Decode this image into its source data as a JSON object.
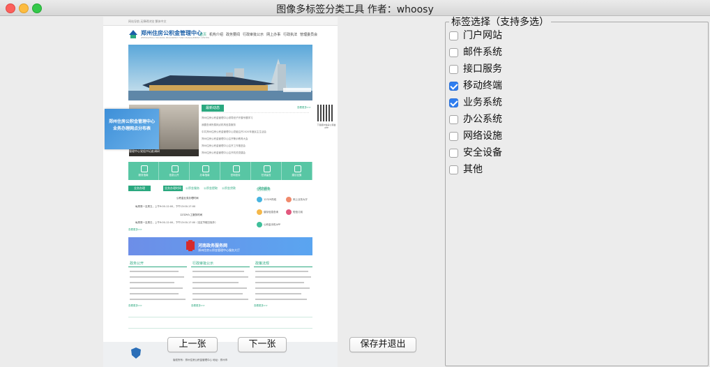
{
  "window": {
    "title": "图像多标签分类工具    作者：whoosy"
  },
  "preview": {
    "site_name": "郑州住房公积金管理中心",
    "site_sub": "ZHENGZHOU HOUSING PROVIDENT FUND MANAGEMENT CENTER",
    "top_links": "网站导航  无障碍浏览  繁体中文",
    "nav": [
      "首页",
      "机构介绍",
      "政务要闻",
      "行政审批公示",
      "网上办事",
      "行政执法",
      "管理委员会"
    ],
    "side_banner": "郑州住房公积金管理中心 业务办理网点分布表",
    "photo_caption": "管理中心党组书记赴调研",
    "news_head": "最新动态",
    "news_more": "查看更多>>",
    "news": [
      "郑州住房公积金管理中心领导班子开展专题学习",
      "我要查询所属网点机构信息服务",
      "中共郑州住房公积金管理中心党组召开2020年度民主生活会",
      "郑州住房公积金管理中心召开警示教育大会",
      "郑州住房公积金管理中心召开工作推进会",
      "郑州住房公积金管理中心召开机关党建会"
    ],
    "qr_caption": "下载郑州住房公积金APP",
    "tiles": [
      "服务指南",
      "信息公开",
      "办事指南",
      "咨询投诉",
      "在线留言",
      "建议征集"
    ],
    "section_tabs": [
      "业务办理",
      "业务办理时间",
      "公积金服务",
      "公积金提取",
      "公积金贷款",
      "政务服务"
    ],
    "hours_title": "公积金业务办理时间",
    "hours_line1": "每周周一至周五，上午9:00-12:00，下午13:00-17:00",
    "hours_line2": "12329人工服务时间",
    "hours_line3": "每周周一至周日，上午9:00-12:00，下午13:00-17:00（法定节假日除外）",
    "convenience_head": "便民服务",
    "convenience": [
      "12329热线",
      "网上业务大厅",
      "缴存信息查询",
      "短信订阅",
      "公积金手机APP"
    ],
    "gov_title": "河南政务服务网",
    "gov_sub": "郑州住房公积金管理中心服务大厅",
    "columns": [
      "政务公开",
      "行政审批公示",
      "政策法规"
    ],
    "more": "查看更多>>",
    "footer": "版权所有：郑州住房公积金管理中心  地址：郑州市"
  },
  "buttons": {
    "prev": "上一张",
    "next": "下一张",
    "save_exit": "保存并退出"
  },
  "tags": {
    "group_label": "标签选择（支持多选）",
    "items": [
      {
        "label": "门户网站",
        "checked": false
      },
      {
        "label": "邮件系统",
        "checked": false
      },
      {
        "label": "接口服务",
        "checked": false
      },
      {
        "label": "移动终端",
        "checked": true
      },
      {
        "label": "业务系统",
        "checked": true
      },
      {
        "label": "办公系统",
        "checked": false
      },
      {
        "label": "网络设施",
        "checked": false
      },
      {
        "label": "安全设备",
        "checked": false
      },
      {
        "label": "其他",
        "checked": false
      }
    ]
  },
  "colors": {
    "checkbox_checked": "#2f7ef0",
    "site_accent": "#2aa87f",
    "site_teal": "#58c6a4"
  }
}
